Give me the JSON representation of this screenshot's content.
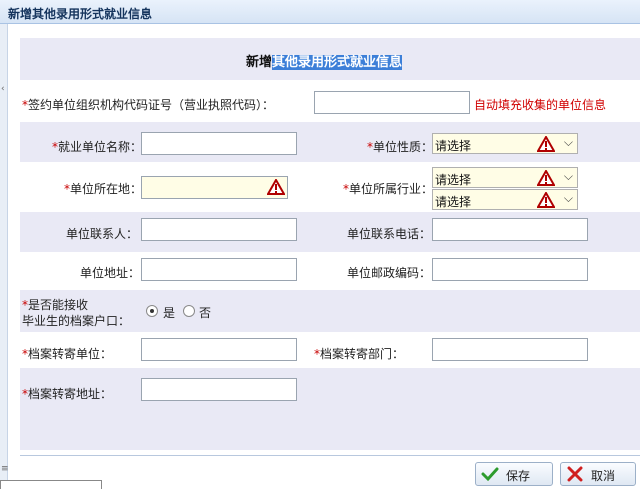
{
  "window": {
    "title": "新增其他录用形式就业信息"
  },
  "form": {
    "heading_prefix": "新增",
    "heading_selected": "其他录用形式就业信息",
    "org_code": {
      "required_mark": "*",
      "label": "签约单位组织机构代码证号（营业执照代码）：",
      "value": "",
      "note": "自动填充收集的单位信息"
    },
    "unit_name": {
      "required_mark": "*",
      "label": "就业单位名称：",
      "value": ""
    },
    "unit_nature": {
      "required_mark": "*",
      "label": "单位性质：",
      "selected": "请选择"
    },
    "unit_location": {
      "required_mark": "*",
      "label": "单位所在地：",
      "value": ""
    },
    "unit_industry": {
      "required_mark": "*",
      "label": "单位所属行业：",
      "selected_1": "请选择",
      "selected_2": "请选择"
    },
    "contact_person": {
      "label": "单位联系人：",
      "value": ""
    },
    "contact_phone": {
      "label": "单位联系电话：",
      "value": ""
    },
    "unit_address": {
      "label": "单位地址：",
      "value": ""
    },
    "postal_code": {
      "label": "单位邮政编码：",
      "value": ""
    },
    "archive_accept": {
      "required_mark": "*",
      "label_line1": "是否能接收",
      "label_line2": "毕业生的档案户口：",
      "option_yes": "是",
      "option_no": "否",
      "selected": "是"
    },
    "archive_unit": {
      "required_mark": "*",
      "label": "档案转寄单位：",
      "value": ""
    },
    "archive_dept": {
      "required_mark": "*",
      "label": "档案转寄部门：",
      "value": ""
    },
    "archive_address": {
      "required_mark": "*",
      "label": "档案转寄地址：",
      "value": ""
    }
  },
  "buttons": {
    "save": "保存",
    "cancel": "取消"
  },
  "colors": {
    "required": "#c80000",
    "accent": "#3c7fd8",
    "band": "#e9e9f5"
  },
  "icons": [
    "warning-icon",
    "chevron-down-icon",
    "check-icon",
    "cross-icon"
  ]
}
